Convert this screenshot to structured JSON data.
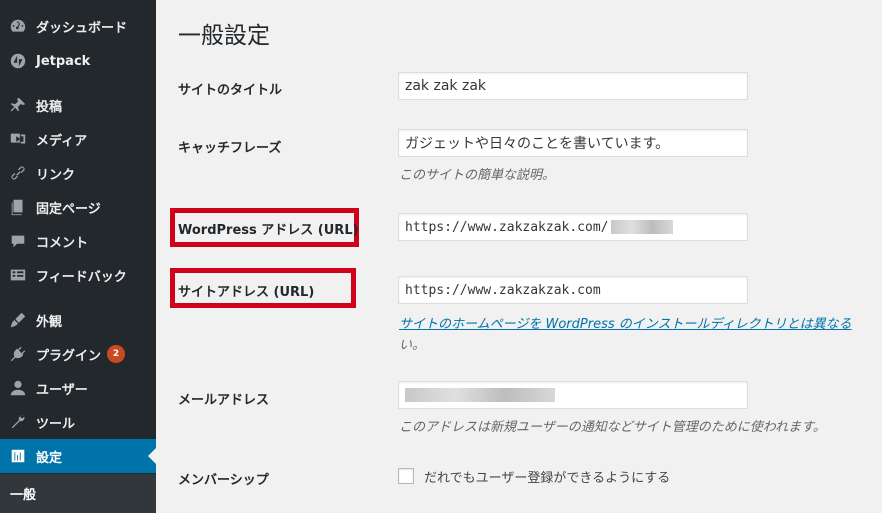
{
  "sidebar": {
    "items": [
      {
        "label": "ダッシュボード",
        "icon": "dashboard-icon"
      },
      {
        "label": "Jetpack",
        "icon": "jetpack-icon"
      },
      {
        "label": "投稿",
        "icon": "pin-icon"
      },
      {
        "label": "メディア",
        "icon": "media-icon"
      },
      {
        "label": "リンク",
        "icon": "link-icon"
      },
      {
        "label": "固定ページ",
        "icon": "page-icon"
      },
      {
        "label": "コメント",
        "icon": "comment-icon"
      },
      {
        "label": "フィードバック",
        "icon": "feedback-icon"
      },
      {
        "label": "外観",
        "icon": "appearance-icon"
      },
      {
        "label": "プラグイン",
        "icon": "plugin-icon",
        "badge": "2"
      },
      {
        "label": "ユーザー",
        "icon": "user-icon"
      },
      {
        "label": "ツール",
        "icon": "tools-icon"
      },
      {
        "label": "設定",
        "icon": "settings-icon",
        "active": true
      }
    ],
    "submenu_current": "一般"
  },
  "main": {
    "title": "一般設定",
    "site_title": {
      "label": "サイトのタイトル",
      "value": "zak zak zak"
    },
    "tagline": {
      "label": "キャッチフレーズ",
      "value": "ガジェットや日々のことを書いています。",
      "description": "このサイトの簡単な説明。"
    },
    "wp_address": {
      "label": "WordPress アドレス (URL)",
      "value": "https://www.zakzakzak.com/"
    },
    "site_address": {
      "label": "サイトアドレス (URL)",
      "value": "https://www.zakzakzak.com",
      "link_text": "サイトのホームページを WordPress のインストールディレクトリとは異なる",
      "tail_text": "い。"
    },
    "admin_email": {
      "label": "メールアドレス",
      "description": "このアドレスは新規ユーザーの通知などサイト管理のために使われます。"
    },
    "membership": {
      "label": "メンバーシップ",
      "checkbox_label": "だれでもユーザー登録ができるようにする"
    }
  },
  "colors": {
    "sidebar_bg": "#23282d",
    "active_bg": "#0073aa",
    "highlight": "#d0021b",
    "badge": "#ca4a1f"
  }
}
